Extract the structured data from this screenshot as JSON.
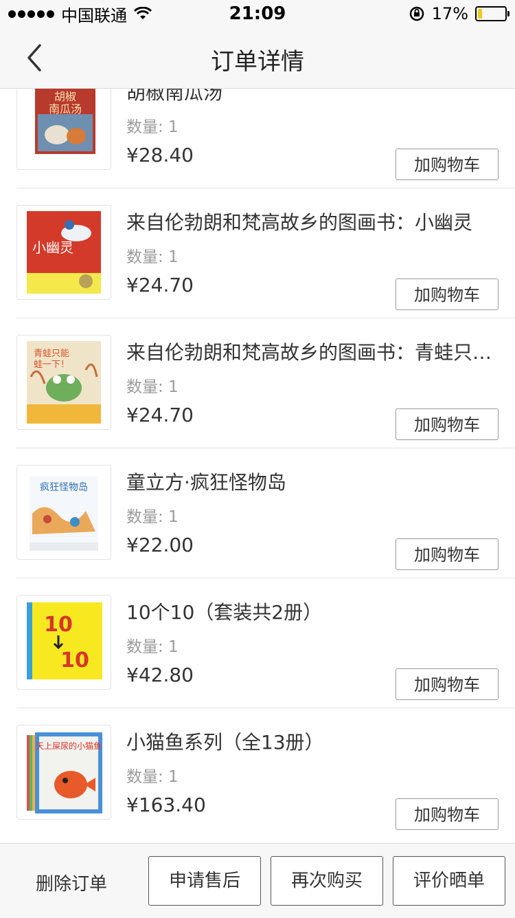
{
  "status_bar": {
    "carrier": "中国联通",
    "time": "21:09",
    "battery": "17%",
    "battery_level": 0.17
  },
  "nav": {
    "title": "订单详情",
    "back_icon": "chevron-left-icon"
  },
  "items": [
    {
      "title": "胡椒南瓜汤",
      "quantity_label": "数量: 1",
      "price": "¥28.40",
      "button": "加购物车",
      "cover_text": "胡椒南瓜汤",
      "cover_color": "#c0392b"
    },
    {
      "title": "来自伦勃朗和梵高故乡的图画书：小幽灵",
      "quantity_label": "数量: 1",
      "price": "¥24.70",
      "button": "加购物车",
      "cover_text": "小幽灵",
      "cover_color": "#d63a2a"
    },
    {
      "title": "来自伦勃朗和梵高故乡的图画书：青蛙只…",
      "quantity_label": "数量: 1",
      "price": "¥24.70",
      "button": "加购物车",
      "cover_text": "青蛙只能蛙一下！",
      "cover_color": "#e9dcc0"
    },
    {
      "title": "童立方·疯狂怪物岛",
      "quantity_label": "数量: 1",
      "price": "¥22.00",
      "button": "加购物车",
      "cover_text": "疯狂怪物岛",
      "cover_color": "#eaf0f6"
    },
    {
      "title": "10个10（套装共2册）",
      "quantity_label": "数量: 1",
      "price": "¥42.80",
      "button": "加购物车",
      "cover_text": "10 10",
      "cover_color": "#f5e61f"
    },
    {
      "title": "小猫鱼系列（全13册）",
      "quantity_label": "数量: 1",
      "price": "¥163.40",
      "button": "加购物车",
      "cover_text": "天上屎尿的小猫鱼",
      "cover_color": "#4a90d9"
    }
  ],
  "bottom_bar": {
    "delete": "删除订单",
    "after_sale": "申请售后",
    "buy_again": "再次购买",
    "review": "评价晒单"
  }
}
